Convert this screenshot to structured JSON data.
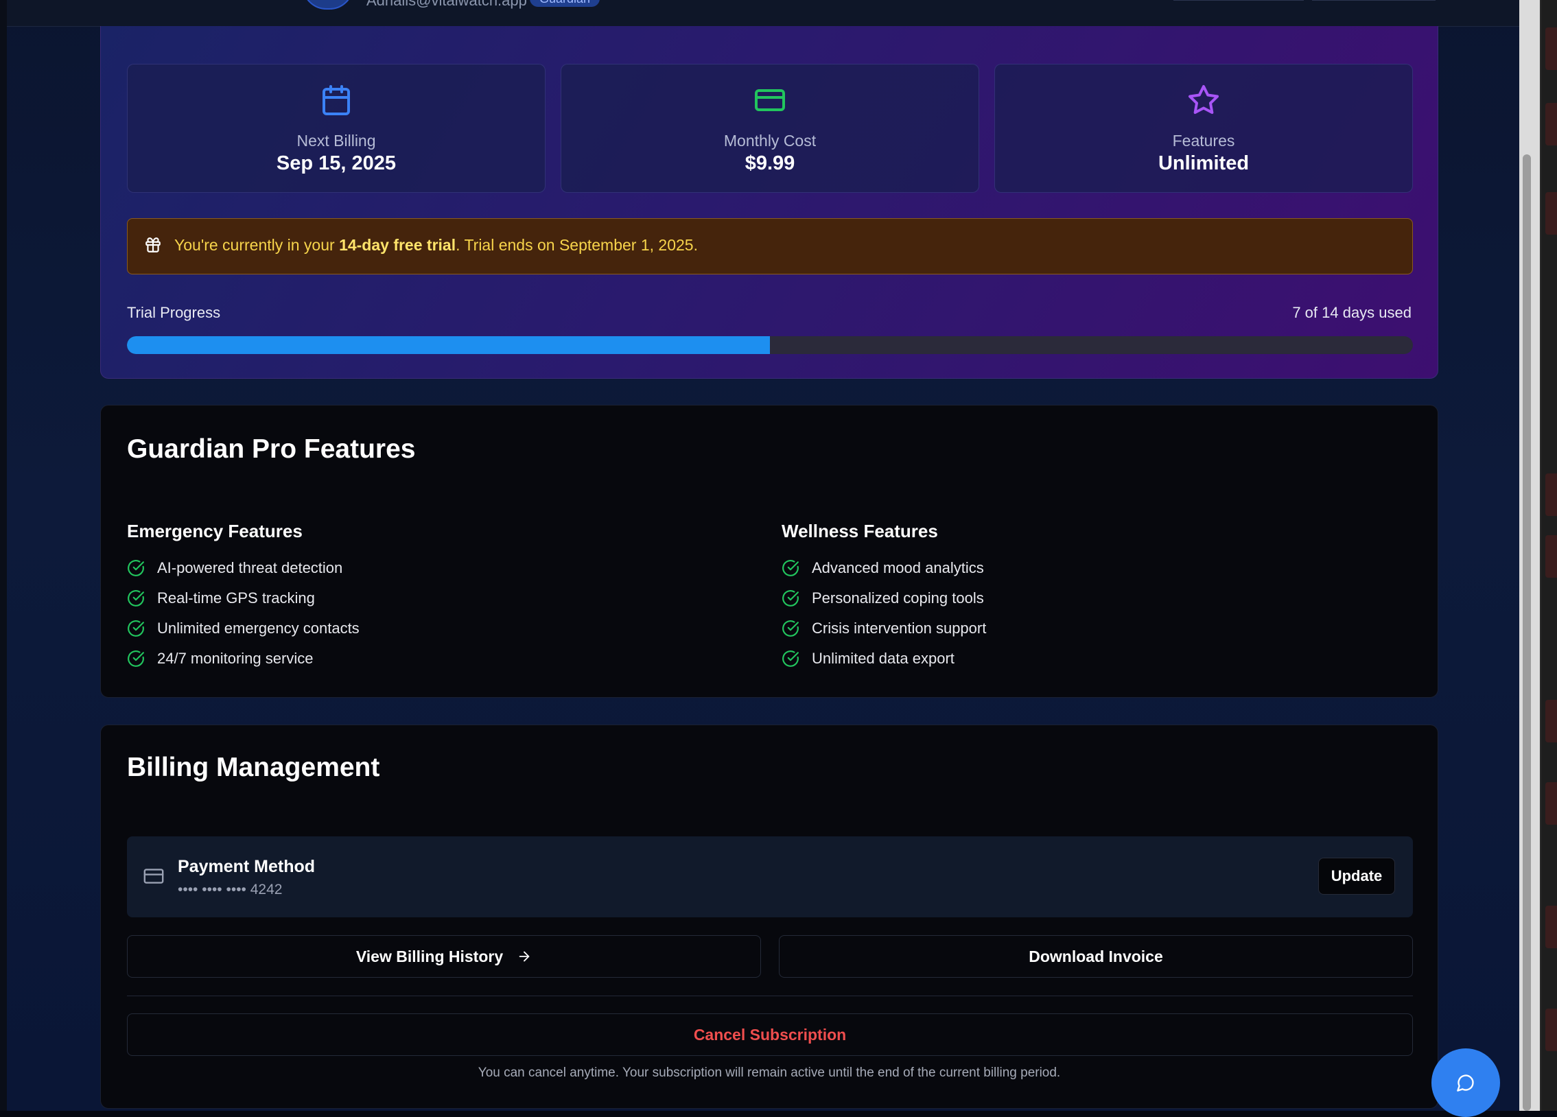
{
  "header": {
    "email": "Adrialis@vitalwatch.app",
    "role_badge": "Guardian"
  },
  "stats": [
    {
      "icon": "calendar-icon",
      "label": "Next Billing",
      "value": "Sep 15, 2025",
      "color": "#3b82f6"
    },
    {
      "icon": "credit-card-icon",
      "label": "Monthly Cost",
      "value": "$9.99",
      "color": "#22c55e"
    },
    {
      "icon": "star-icon",
      "label": "Features",
      "value": "Unlimited",
      "color": "#a855f7"
    }
  ],
  "trial_notice": {
    "icon": "gift-icon",
    "prefix": "You're currently in your ",
    "highlight": "14-day free trial",
    "suffix": ". Trial ends on September 1, 2025."
  },
  "trial_progress": {
    "label": "Trial Progress",
    "status": "7 of 14 days used",
    "days_used": 7,
    "days_total": 14,
    "fraction": 0.5
  },
  "features": {
    "title": "Guardian Pro Features",
    "columns": [
      {
        "heading": "Emergency Features",
        "items": [
          "AI-powered threat detection",
          "Real-time GPS tracking",
          "Unlimited emergency contacts",
          "24/7 monitoring service"
        ]
      },
      {
        "heading": "Wellness Features",
        "items": [
          "Advanced mood analytics",
          "Personalized coping tools",
          "Crisis intervention support",
          "Unlimited data export"
        ]
      }
    ]
  },
  "billing": {
    "title": "Billing Management",
    "payment_method": {
      "label": "Payment Method",
      "masked_number": "•••• •••• •••• 4242",
      "update_label": "Update"
    },
    "view_history_label": "View Billing History",
    "download_invoice_label": "Download Invoice",
    "cancel_label": "Cancel Subscription",
    "cancel_note": "You can cancel anytime. Your subscription will remain active until the end of the current billing period."
  },
  "colors": {
    "accent_blue": "#1d8ff0",
    "check_green": "#22c55e",
    "danger_red": "#ef4e4e",
    "trial_yellow": "#f7d44b"
  },
  "chat_button": {
    "icon": "chat-bubble-icon"
  }
}
